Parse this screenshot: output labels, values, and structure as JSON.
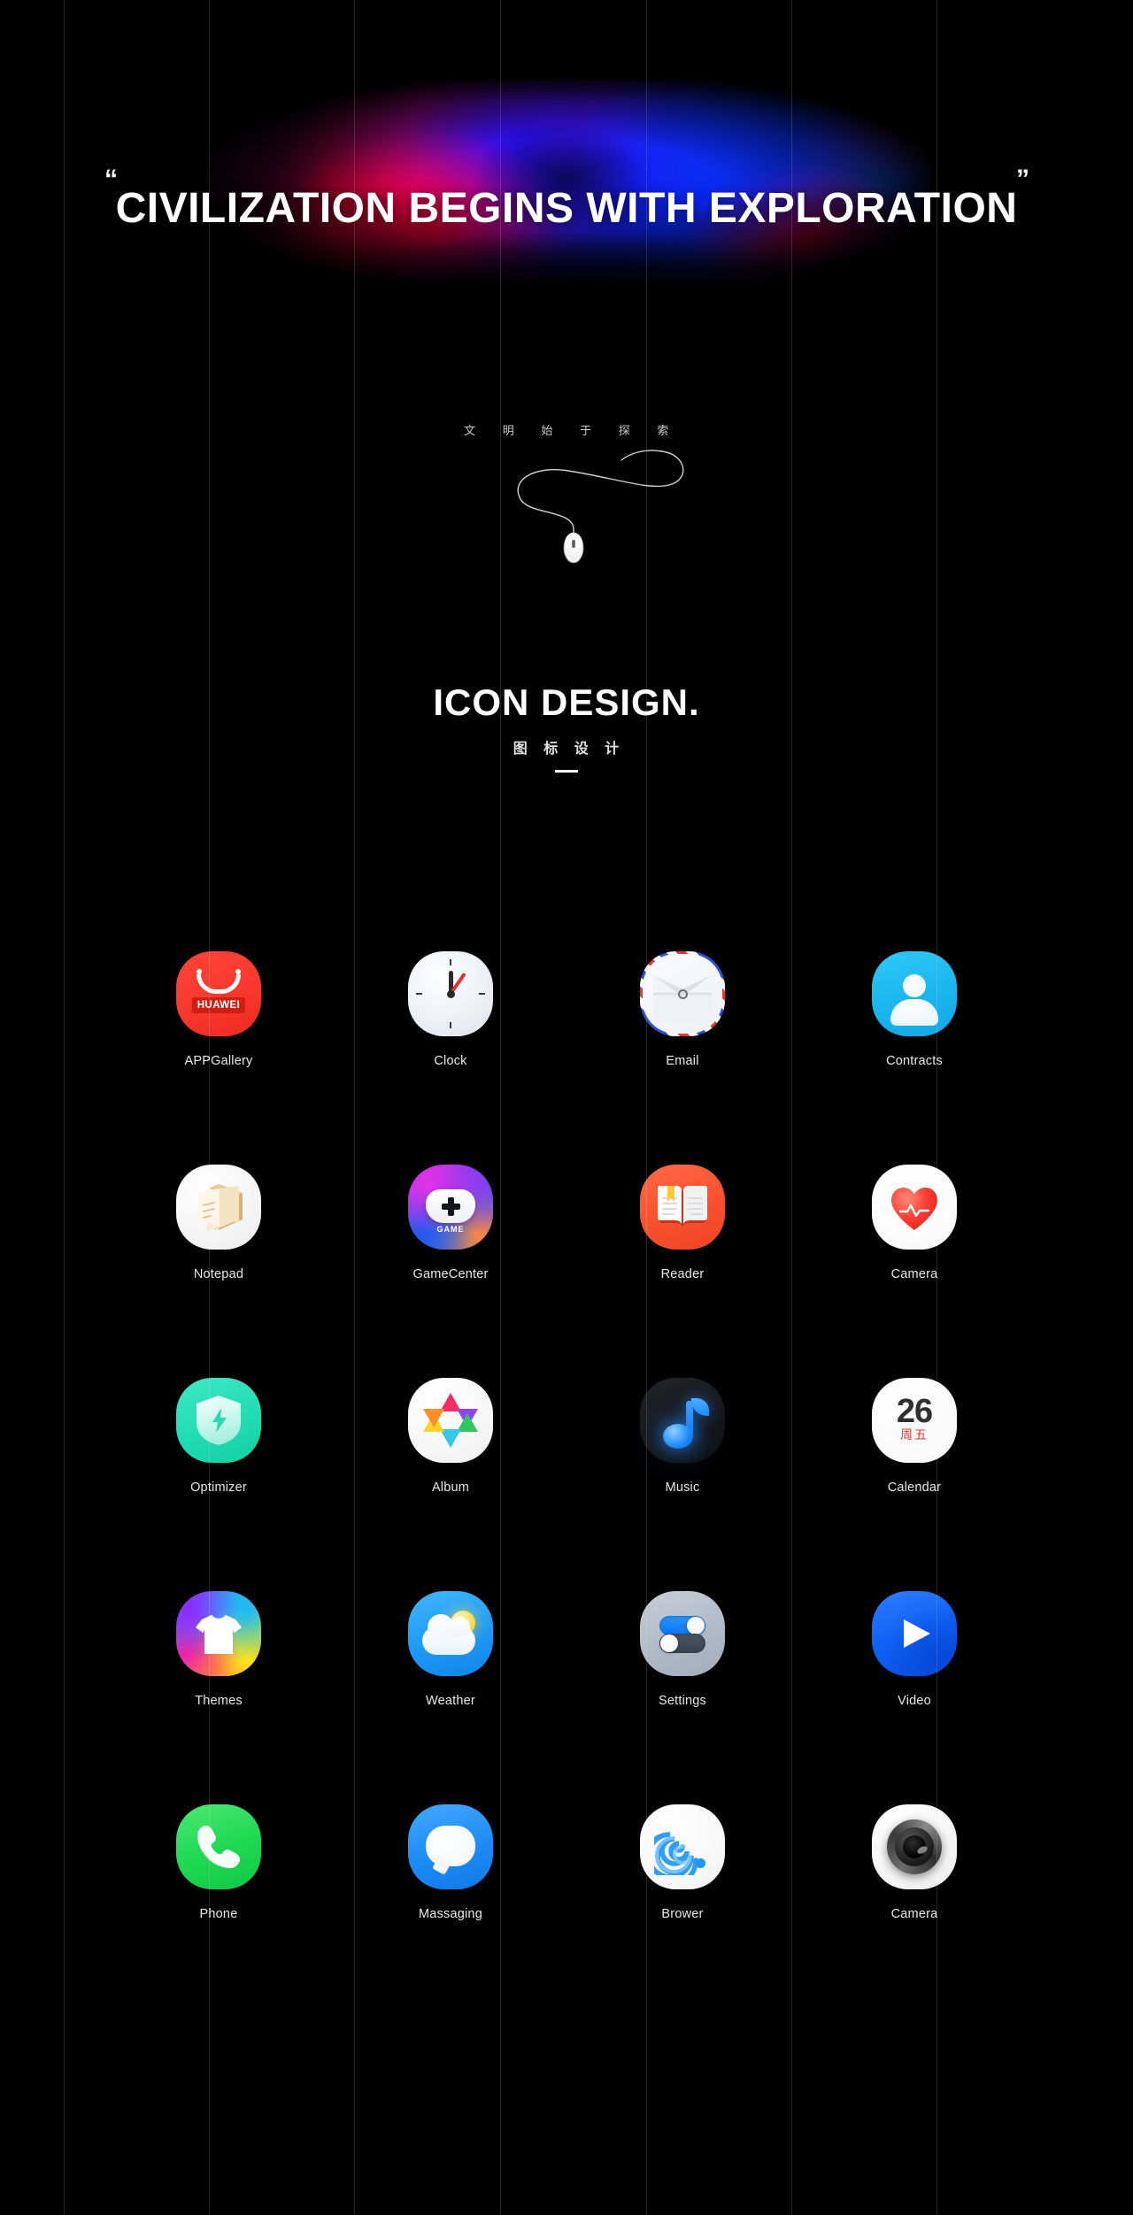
{
  "hero": {
    "quote_open": "“",
    "quote_close": "”",
    "title": "CIVILIZATION BEGINS WITH EXPLORATION",
    "subtitle_chars": [
      "文",
      "明",
      "始",
      "于",
      "探",
      "索"
    ]
  },
  "section": {
    "title": "ICON DESIGN.",
    "subtitle_chars": [
      "图",
      "标",
      "设",
      "计"
    ]
  },
  "apps": [
    {
      "label": "APPGallery",
      "icon": "appgallery-icon",
      "brand": "HUAWEI",
      "color": "#f8372b"
    },
    {
      "label": "Clock",
      "icon": "clock-icon",
      "color": "#eceef3"
    },
    {
      "label": "Email",
      "icon": "email-icon",
      "color": "#eef0f4"
    },
    {
      "label": "Contracts",
      "icon": "contacts-icon",
      "color": "#1bb8ef"
    },
    {
      "label": "Notepad",
      "icon": "notepad-icon",
      "color": "#f2f2f2"
    },
    {
      "label": "GameCenter",
      "icon": "gamepad-icon",
      "badge": "GAME",
      "color": "#6a3df2"
    },
    {
      "label": "Reader",
      "icon": "book-icon",
      "color": "#f8502f"
    },
    {
      "label": "Camera",
      "icon": "heart-pulse-icon",
      "color": "#f93a2e"
    },
    {
      "label": "Optimizer",
      "icon": "shield-bolt-icon",
      "color": "#23ddb4"
    },
    {
      "label": "Album",
      "icon": "star-flower-icon",
      "color": "#f4f4f4"
    },
    {
      "label": "Music",
      "icon": "music-note-icon",
      "color": "#17181b"
    },
    {
      "label": "Calendar",
      "icon": "calendar-icon",
      "day": "26",
      "weekday": "周五",
      "color": "#fafafa"
    },
    {
      "label": "Themes",
      "icon": "tshirt-icon",
      "color": "#21c6f2"
    },
    {
      "label": "Weather",
      "icon": "cloud-sun-icon",
      "color": "#1f9cf5"
    },
    {
      "label": "Settings",
      "icon": "toggles-icon",
      "color": "#b2bac8"
    },
    {
      "label": "Video",
      "icon": "play-icon",
      "color": "#1060f5"
    },
    {
      "label": "Phone",
      "icon": "phone-handset-icon",
      "color": "#1fd954"
    },
    {
      "label": "Massaging",
      "icon": "chat-bubble-icon",
      "color": "#1f8df5"
    },
    {
      "label": "Brower",
      "icon": "spiral-icon",
      "color": "#1e96f5"
    },
    {
      "label": "Camera",
      "icon": "camera-lens-icon",
      "color": "#3a3a3a"
    }
  ]
}
